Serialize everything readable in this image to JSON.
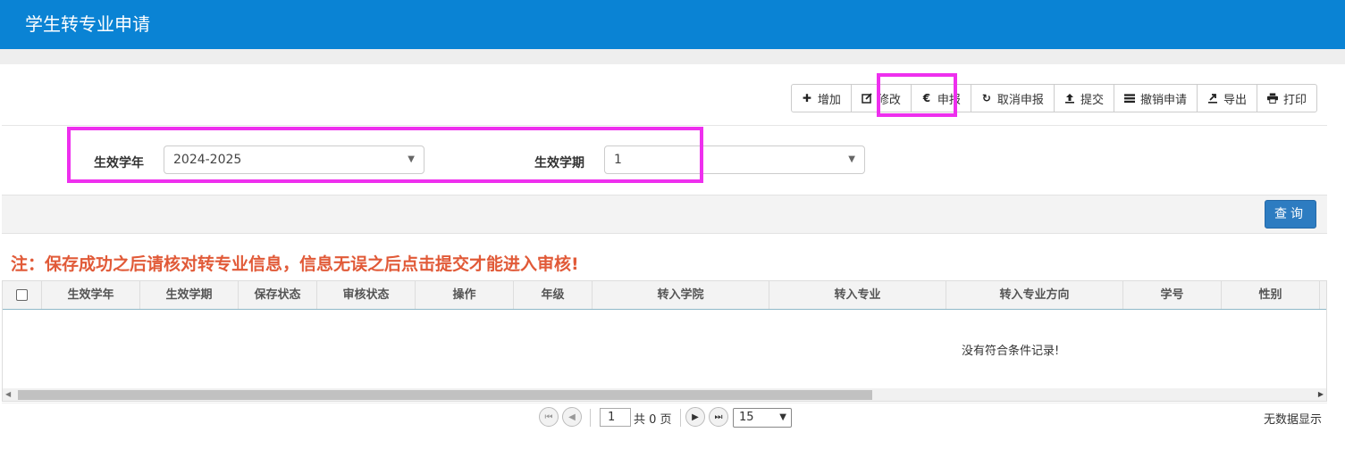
{
  "header": {
    "title": "学生转专业申请"
  },
  "toolbar": {
    "add": "增加",
    "edit": "修改",
    "declare": "申报",
    "cancel_declare": "取消申报",
    "submit": "提交",
    "revoke": "撤销申请",
    "export": "导出",
    "print": "打印"
  },
  "filter": {
    "year_label": "生效学年",
    "year_value": "2024-2025",
    "term_label": "生效学期",
    "term_value": "1"
  },
  "query": {
    "label": "查询"
  },
  "notice": "注：保存成功之后请核对转专业信息，信息无误之后点击提交才能进入审核!",
  "table": {
    "columns": [
      "生效学年",
      "生效学期",
      "保存状态",
      "审核状态",
      "操作",
      "年级",
      "转入学院",
      "转入专业",
      "转入专业方向",
      "学号",
      "性别"
    ],
    "empty": "没有符合条件记录!"
  },
  "pager": {
    "page": "1",
    "total_text": "共 0 页",
    "page_size": "15",
    "info": "无数据显示"
  },
  "colors": {
    "header": "#0a83d4",
    "highlight": "#ee2fee",
    "notice": "#e15a38",
    "query_button": "#2d7cc1"
  }
}
